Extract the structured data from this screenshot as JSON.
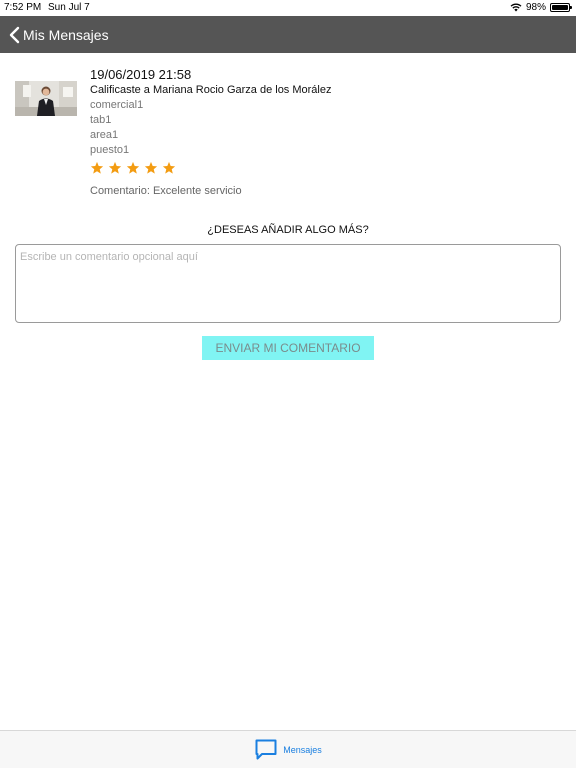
{
  "status_bar": {
    "time": "7:52 PM",
    "date": "Sun Jul 7",
    "battery": "98%",
    "battery_level": 0.98
  },
  "nav": {
    "back_label": "Mis Mensajes"
  },
  "message": {
    "date": "19/06/2019 21:58",
    "title": "Calificaste a Mariana Rocio Garza de los Morález",
    "comercial": "comercial1",
    "tab": "tab1",
    "area": "area1",
    "puesto": "puesto1",
    "rating": 5,
    "rating_max": 5,
    "star_color": "#f39c12",
    "comment": "Comentario: Excelente servicio"
  },
  "form": {
    "question": "¿DESEAS AÑADIR ALGO MÁS?",
    "comment_placeholder": "Escribe un comentario opcional aquí",
    "comment_value": "",
    "send_label": "ENVIAR MI COMENTARIO",
    "send_color": "#80f4f3"
  },
  "tab_bar": {
    "tabs": [
      {
        "label": "Mensajes",
        "icon": "chat-bubble-icon",
        "active": true
      }
    ],
    "accent": "#1a7fe0"
  }
}
